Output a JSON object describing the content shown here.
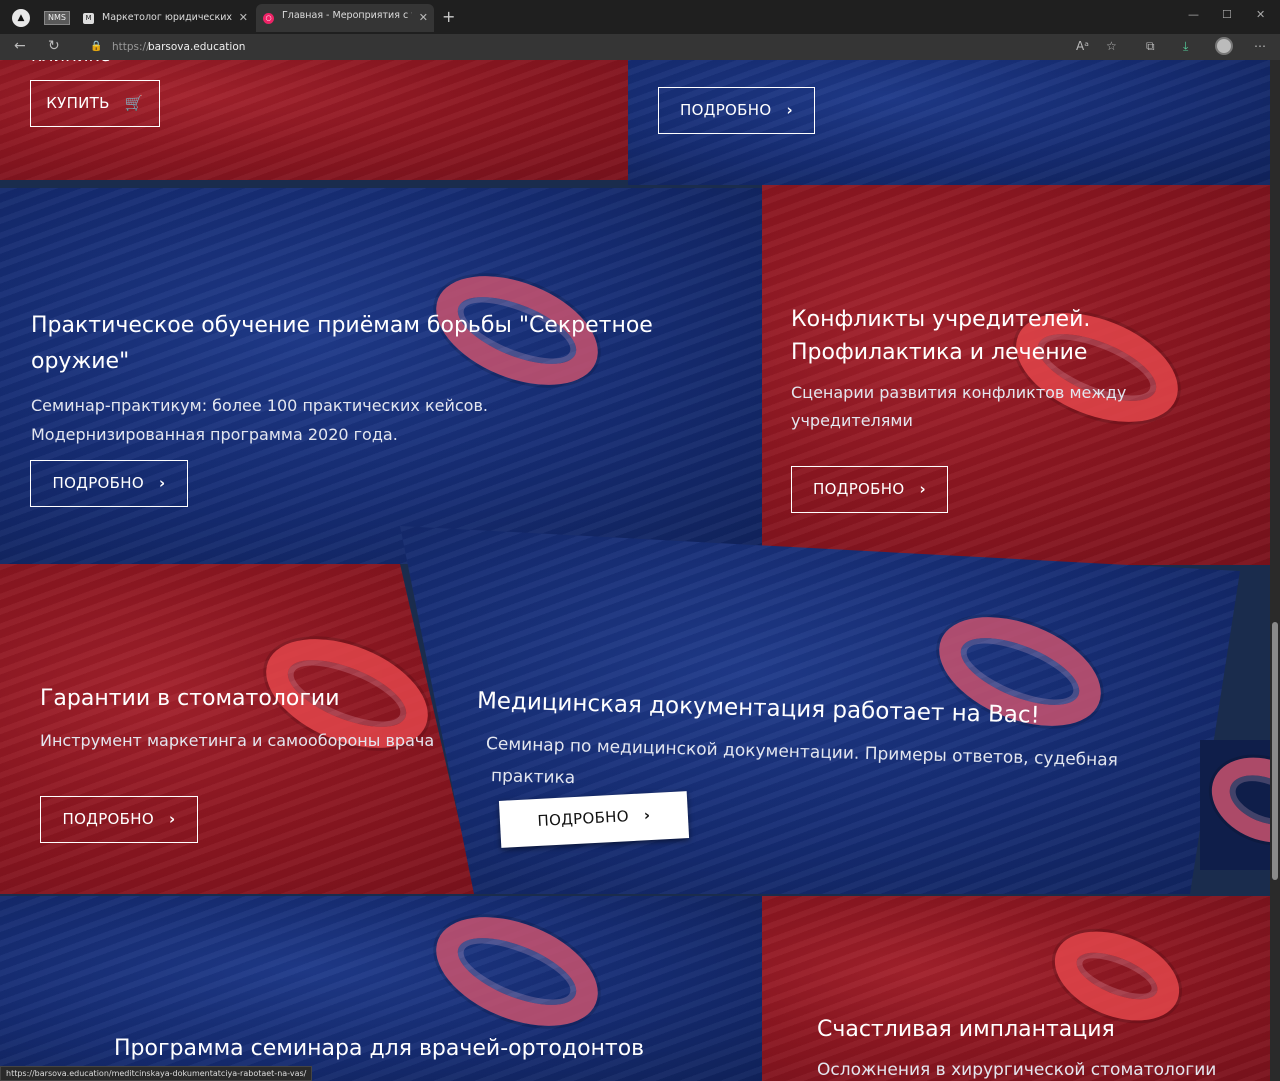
{
  "browser": {
    "tabs": [
      {
        "label": "NMS",
        "pinned": true
      },
      {
        "label": "Маркетолог юридических услуг",
        "favicon": "M"
      },
      {
        "label": "Главная - Мероприятия с участ",
        "favicon": "ring"
      }
    ],
    "url_protocol": "https://",
    "url_host": "barsova.education",
    "status_url": "https://barsova.education/meditcinskaya-dokumentatciya-rabotaet-na-vas/"
  },
  "panels": {
    "top_left": {
      "partial_text": "клинике",
      "button": "КУПИТЬ",
      "button_icon": "cart-icon"
    },
    "top_right": {
      "button": "ПОДРОБНО"
    },
    "secret_weapon": {
      "title": "Практическое обучение приёмам борьбы \"Секретное оружие\"",
      "desc_line1": "Семинар-практикум: более 100 практических кейсов.",
      "desc_line2": "Модернизированная программа 2020 года.",
      "button": "ПОДРОБНО"
    },
    "founders": {
      "title_line1": "Конфликты учредителей.",
      "title_line2": "Профилактика и лечение",
      "desc_line1": "Сценарии развития конфликтов между",
      "desc_line2": "учредителями",
      "button": "ПОДРОБНО"
    },
    "dentistry": {
      "title": "Гарантии в стоматологии",
      "desc": "Инструмент маркетинга и самообороны врача",
      "button": "ПОДРОБНО"
    },
    "medical_docs": {
      "title": "Медицинская документация работает на Вас!",
      "desc_line1": "Семинар по медицинской документации. Примеры ответов, судебная",
      "desc_line2": "практика",
      "button": "ПОДРОБНО"
    },
    "orthodontists": {
      "title": "Программа семинара для врачей-ортодонтов"
    },
    "implant": {
      "title": "Счастливая имплантация",
      "desc": "Осложнения в хирургической стоматологии"
    }
  },
  "colors": {
    "red_panel": "#8d1721",
    "blue_panel": "#162d74",
    "accent_ring": "#d9535f"
  }
}
